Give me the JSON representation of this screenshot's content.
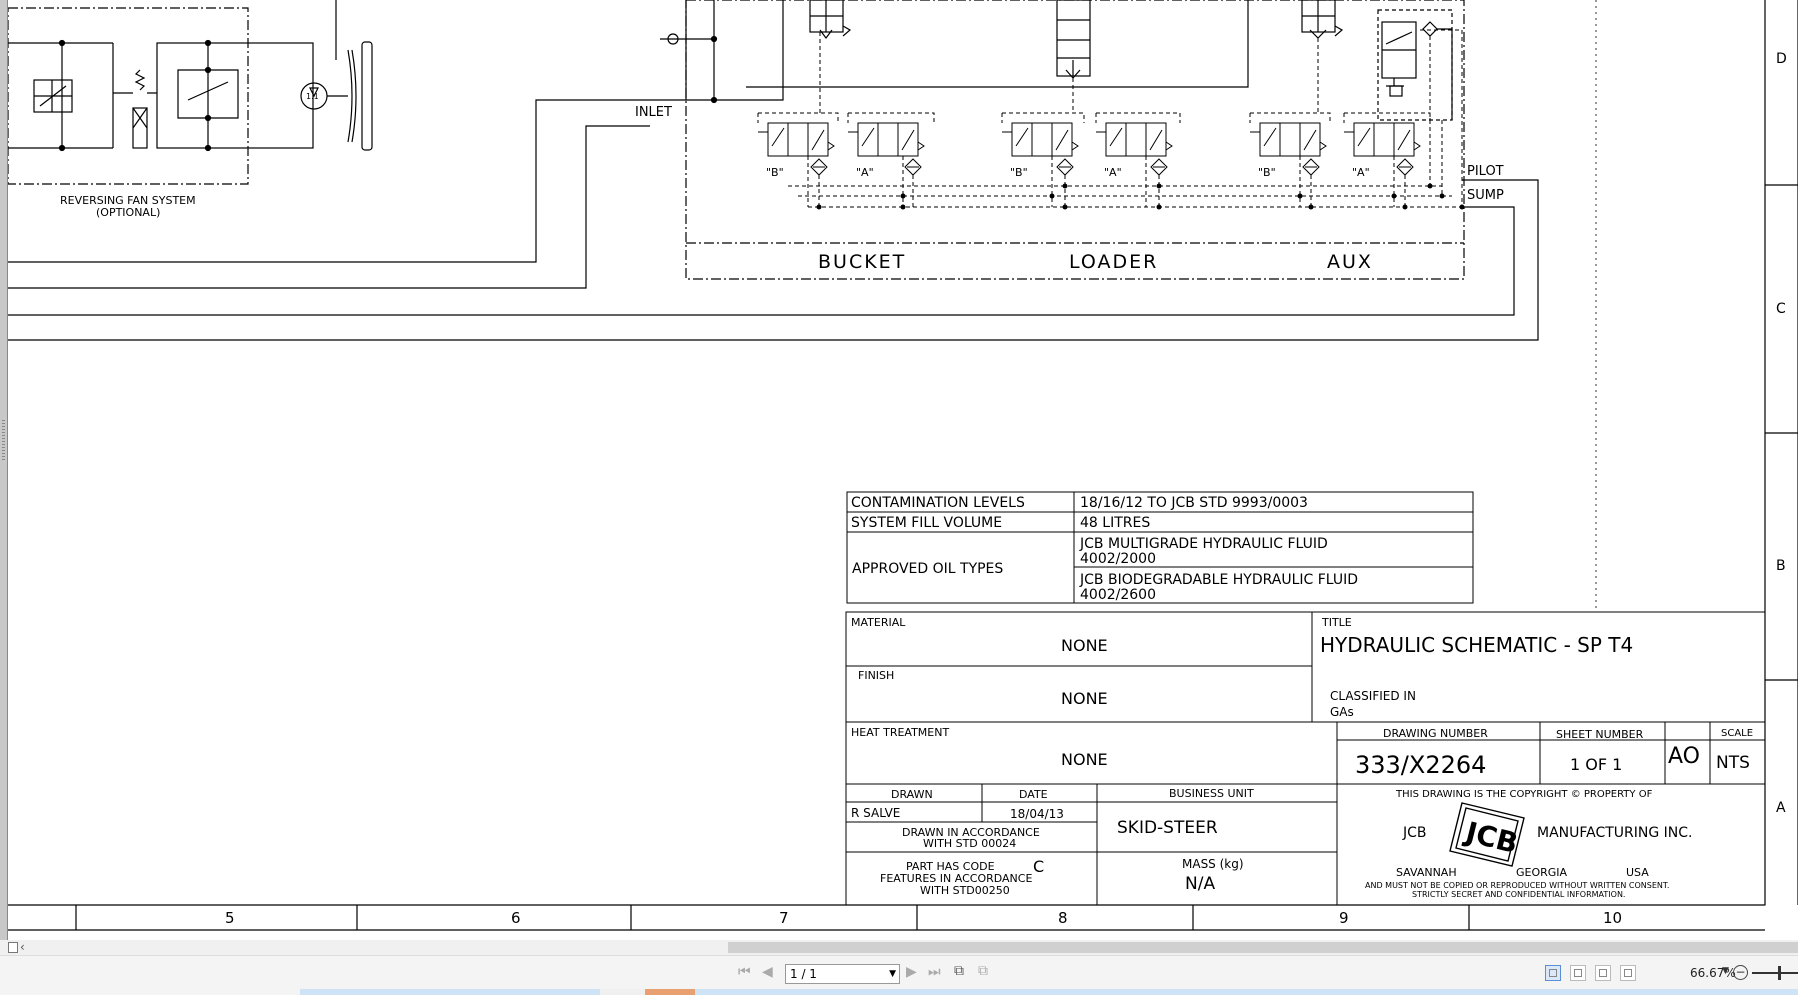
{
  "drawing": {
    "fan_system": {
      "label_line1": "REVERSING FAN SYSTEM",
      "label_line2": "(OPTIONAL)",
      "motor_label": "1.1"
    },
    "port_labels": {
      "inlet": "INLET",
      "pilot": "PILOT",
      "sump": "SUMP"
    },
    "sections": {
      "bucket": "BUCKET",
      "loader": "LOADER",
      "aux": "AUX"
    },
    "valve_labels": {
      "b": "\"B\"",
      "a": "\"A\""
    },
    "border": {
      "rows": [
        "D",
        "C",
        "B",
        "A"
      ],
      "columns": [
        "5",
        "6",
        "7",
        "8",
        "9",
        "10"
      ]
    },
    "spec_table": {
      "contamination_label": "CONTAMINATION LEVELS",
      "contamination_value": "18/16/12 TO JCB STD 9993/0003",
      "fill_label": "SYSTEM FILL VOLUME",
      "fill_value": "48 LITRES",
      "oil_label": "APPROVED OIL TYPES",
      "oil1_line1": "JCB MULTIGRADE HYDRAULIC FLUID",
      "oil1_line2": "4002/2000",
      "oil2_line1": "JCB BIODEGRADABLE HYDRAULIC FLUID",
      "oil2_line2": "4002/2600"
    },
    "title_block": {
      "material_label": "MATERIAL",
      "material_value": "NONE",
      "finish_label": "FINISH",
      "finish_value": "NONE",
      "heat_label": "HEAT TREATMENT",
      "heat_value": "NONE",
      "title_label": "TITLE",
      "title_value": "HYDRAULIC SCHEMATIC - SP T4",
      "classified_label": "CLASSIFIED IN",
      "classified_value": "GAs",
      "drawing_number_label": "DRAWING NUMBER",
      "drawing_number_value": "333/X2264",
      "sheet_number_label": "SHEET NUMBER",
      "sheet_number_value": "1 OF 1",
      "size_value": "AO",
      "scale_label": "SCALE",
      "scale_value": "NTS",
      "drawn_label": "DRAWN",
      "drawn_value": "R SALVE",
      "date_label": "DATE",
      "date_value": "18/04/13",
      "business_unit_label": "BUSINESS UNIT",
      "business_unit_value": "SKID-STEER",
      "accordance_line1": "DRAWN IN ACCORDANCE",
      "accordance_line2": "WITH STD 00024",
      "part_code_line1": "PART HAS CODE",
      "part_code_letter": "C",
      "part_code_line2": "FEATURES IN ACCORDANCE",
      "part_code_line3": "WITH STD00250",
      "mass_label": "MASS (kg)",
      "mass_value": "N/A",
      "copyright_line": "THIS DRAWING IS THE COPYRIGHT © PROPERTY OF",
      "company_left": "JCB",
      "logo_text": "JCB",
      "company_right": "MANUFACTURING INC.",
      "city": "SAVANNAH",
      "state": "GEORGIA",
      "country": "USA",
      "notice_line1": "AND MUST NOT BE COPIED OR REPRODUCED WITHOUT WRITTEN CONSENT.",
      "notice_line2": "STRICTLY SECRET AND CONFIDENTIAL INFORMATION."
    }
  },
  "toolbar": {
    "page_selector": "1 / 1",
    "zoom": "66.67%"
  }
}
